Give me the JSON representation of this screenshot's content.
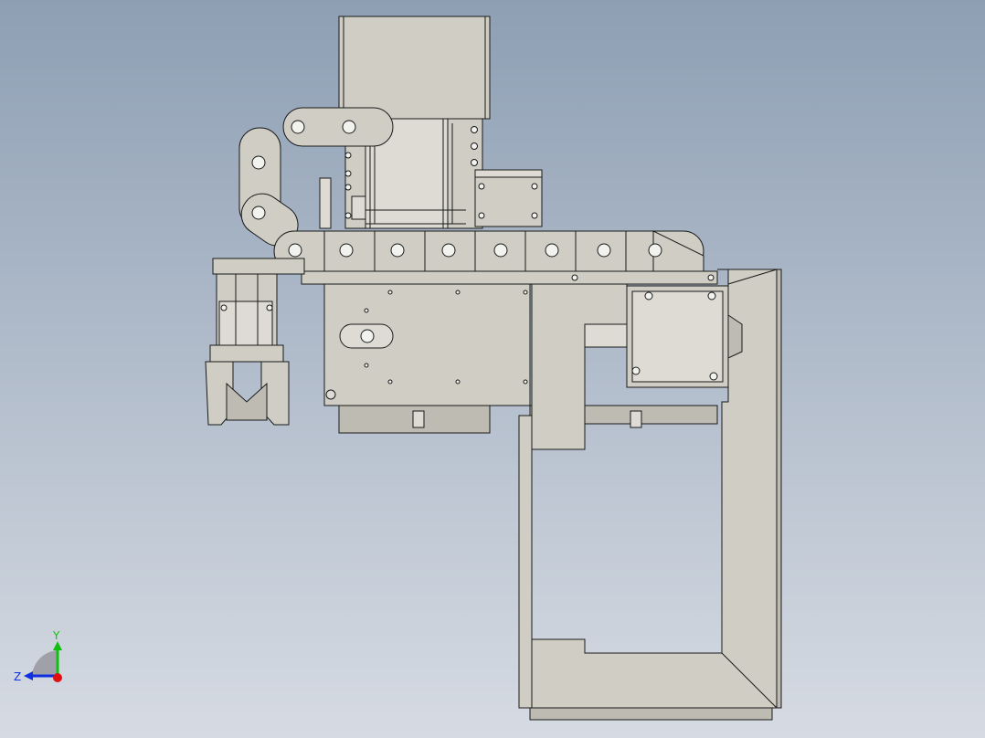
{
  "viewport": {
    "background_top": "#8e9fb4",
    "background_bottom": "#d6dbe3"
  },
  "colors": {
    "part_fill": "#cfcdc4",
    "part_fill_dark": "#bdbbb2",
    "part_fill_light": "#dddbd3",
    "edge": "#1a1a1a",
    "hole": "#f2f2ee"
  },
  "triad": {
    "y_label": "Y",
    "z_label": "Z",
    "x_color": "#e01010",
    "y_color": "#10c010",
    "z_color": "#1030e0"
  }
}
